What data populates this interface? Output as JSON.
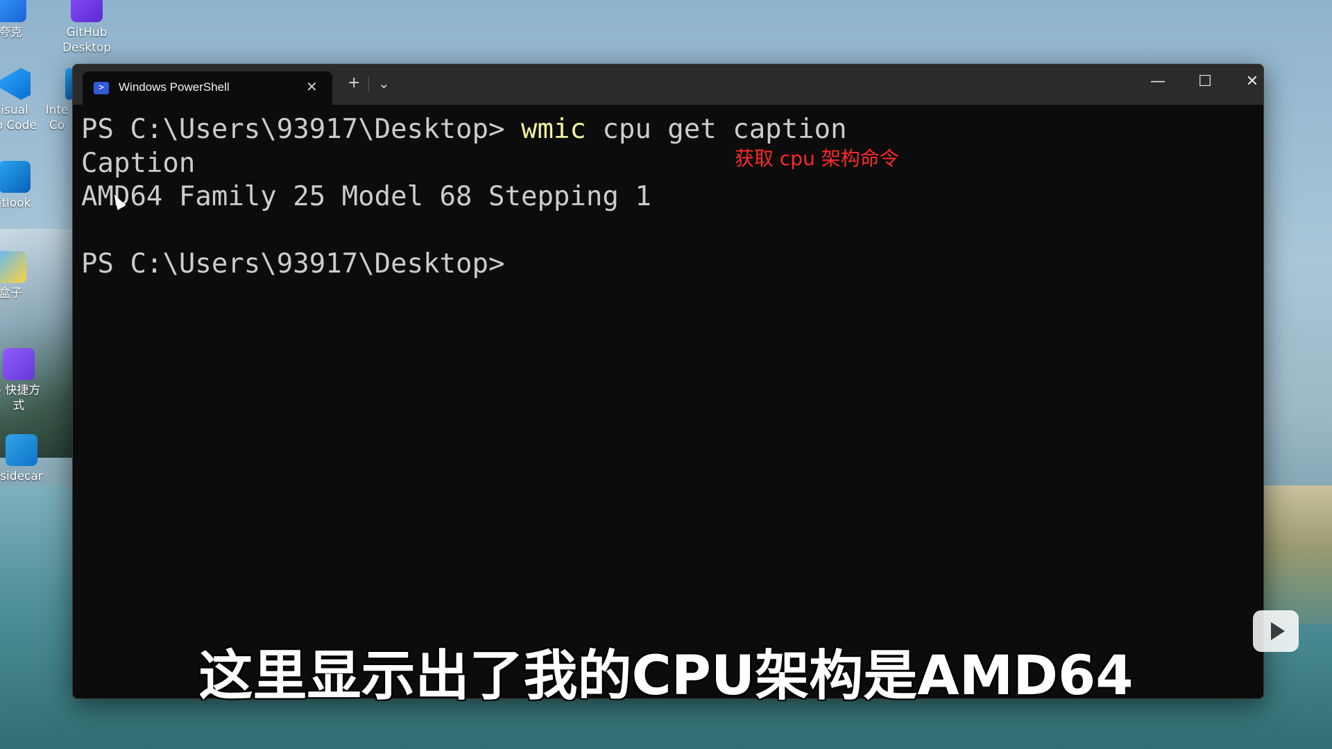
{
  "desktop": {
    "icons": [
      {
        "label": "夸克",
        "icon": "quark-icon"
      },
      {
        "label": "GitHub",
        "label2": "Desktop",
        "icon": "github-desktop-icon"
      },
      {
        "label": "isual",
        "label2": "io Code",
        "icon": "vscode-icon"
      },
      {
        "label": "Inte",
        "label2": "Co",
        "icon": "intel-icon"
      },
      {
        "label": "itlook",
        "icon": "outlook-icon"
      },
      {
        "label": "盒子",
        "icon": "box-icon"
      },
      {
        "label": "- 快捷方",
        "label2": "式",
        "icon": "video-shortcut-icon"
      },
      {
        "label": "sidecar",
        "icon": "sidecar-icon"
      }
    ]
  },
  "terminal": {
    "tab_title": "Windows PowerShell",
    "tab_icon": "powershell-icon",
    "new_tab": "+",
    "dropdown": "⌄",
    "close_tab": "✕",
    "controls": {
      "minimize": "—",
      "maximize": "☐",
      "close": "✕"
    },
    "lines": {
      "prompt1": "PS C:\\Users\\93917\\Desktop> ",
      "cmd_keyword": "wmic",
      "cmd_rest": " cpu get caption",
      "header": "Caption",
      "result": "AMD64 Family 25 Model 68 Stepping 1",
      "prompt2": "PS C:\\Users\\93917\\Desktop>"
    },
    "annotation": "获取 cpu 架构命令"
  },
  "subtitle": "这里显示出了我的CPU架构是AMD64",
  "watermark_icon": "bilibili-tv-icon"
}
